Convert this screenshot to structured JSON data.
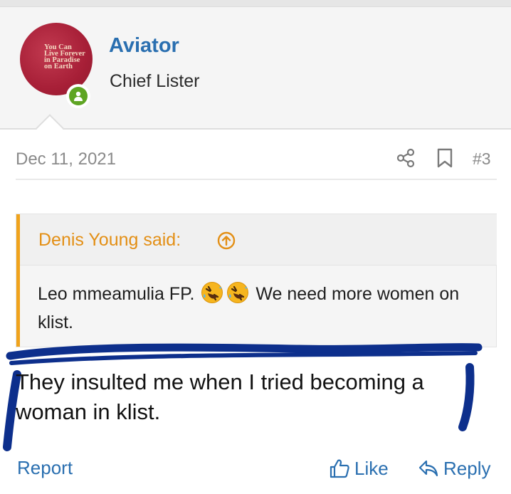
{
  "user": {
    "name": "Aviator",
    "title": "Chief Lister",
    "avatar_text": [
      "You Can",
      "Live Forever",
      "in Paradise",
      "on Earth"
    ],
    "online_status_icon": "user-online-icon"
  },
  "post": {
    "date": "Dec 11, 2021",
    "number": "#3"
  },
  "quote": {
    "author_line": "Denis Young said:",
    "text_before": "Leo mmeamulia FP.",
    "text_after": "We need more women on klist."
  },
  "message": {
    "text": "They insulted me when I tried becoming a woman in klist."
  },
  "actions": {
    "report": "Report",
    "like": "Like",
    "reply": "Reply"
  },
  "icons": [
    "share-icon",
    "bookmark-icon",
    "arrow-up-circle-icon",
    "rofl-emoji-icon",
    "thumbs-up-icon",
    "reply-icon"
  ],
  "colors": {
    "link_blue": "#2a6fb0",
    "quote_accent": "#f0a31c",
    "online_green": "#5fa524",
    "scribble_navy": "#0d2f8c"
  }
}
